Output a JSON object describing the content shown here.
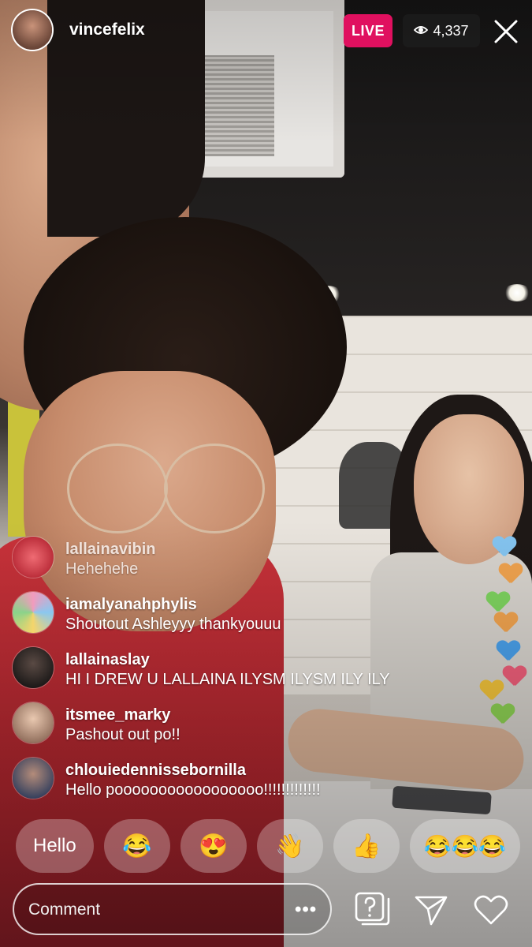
{
  "header": {
    "username": "vincefelix",
    "live_label": "LIVE",
    "viewer_count": "4,337",
    "icons": {
      "viewers": "eye-icon",
      "close": "close-icon"
    }
  },
  "comments": [
    {
      "username": "lallainavibin",
      "message": "Hehehehe",
      "avatar_color": "#d94452"
    },
    {
      "username": "iamalyanahphylis",
      "message": "Shoutout Ashleyyy thankyouuu",
      "avatar_color": "#7fb5e0"
    },
    {
      "username": "lallainaslay",
      "message": "HI I DREW U LALLAINA ILYSM ILYSM ILY ILY",
      "avatar_color": "#3b3737"
    },
    {
      "username": "itsmee_marky",
      "message": "Pashout out po!!",
      "avatar_color": "#c9a58c"
    },
    {
      "username": "chlouiedennissebornilla",
      "message": "Hello pooooooooooooooooo!!!!!!!!!!!!!",
      "avatar_color": "#3a4b6b"
    }
  ],
  "quick_replies": {
    "text": "Hello",
    "joy": "😂",
    "heart_eyes": "😍",
    "wave": "👋",
    "thumbs_up": "👍",
    "triple_joy": "😂😂😂"
  },
  "footer": {
    "comment_placeholder": "Comment",
    "more": "•••",
    "icons": {
      "question": "question-box-icon",
      "send": "send-icon",
      "like": "heart-icon"
    }
  },
  "colors": {
    "live": "#e0105f"
  }
}
